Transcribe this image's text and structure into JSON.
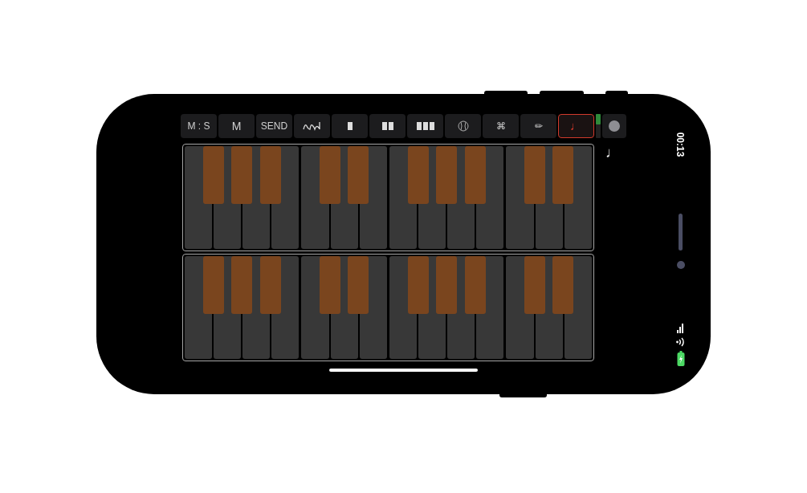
{
  "toolbar": [
    {
      "kind": "text",
      "label": "M : S",
      "selected": false
    },
    {
      "kind": "text",
      "label": "M",
      "selected": false
    },
    {
      "kind": "text",
      "label": "SEND",
      "selected": false
    },
    {
      "kind": "wave",
      "selected": false
    },
    {
      "kind": "onebar",
      "selected": false
    },
    {
      "kind": "twobars",
      "selected": false
    },
    {
      "kind": "threebars",
      "selected": false
    },
    {
      "kind": "ball",
      "selected": false
    },
    {
      "kind": "text",
      "label": "⌘",
      "selected": false
    },
    {
      "kind": "text",
      "label": "✏",
      "selected": false
    },
    {
      "kind": "note",
      "label": "♩",
      "selected": true
    }
  ],
  "meter": {
    "level": 0.45
  },
  "note_label": "♩",
  "status": {
    "time": "00:13",
    "battery_charging": true
  }
}
